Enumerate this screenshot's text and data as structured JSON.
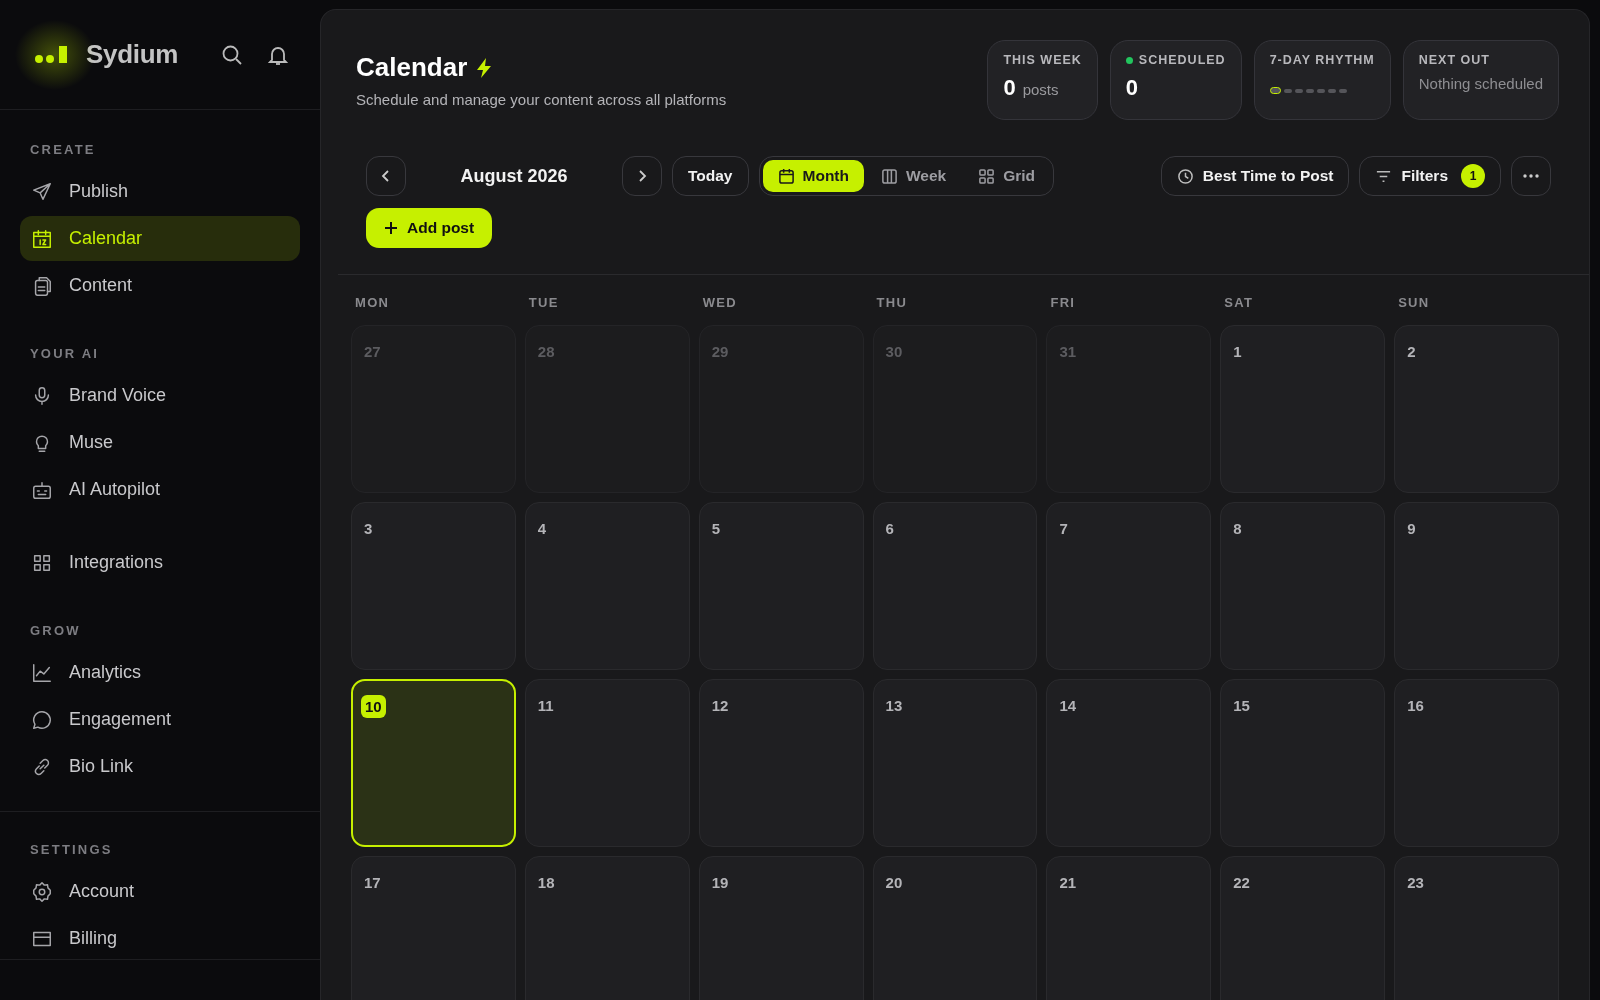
{
  "brand": {
    "name": "Sydium"
  },
  "sidebar": {
    "sections": [
      {
        "title": "CREATE",
        "items": [
          {
            "label": "Publish",
            "selected": false
          },
          {
            "label": "Calendar",
            "selected": true
          },
          {
            "label": "Content",
            "selected": false
          }
        ]
      },
      {
        "title": "YOUR AI",
        "items": [
          {
            "label": "Brand Voice",
            "selected": false
          },
          {
            "label": "Muse",
            "selected": false
          },
          {
            "label": "AI Autopilot",
            "selected": false
          }
        ]
      },
      {
        "items": [
          {
            "label": "Integrations",
            "selected": false
          }
        ]
      },
      {
        "title": "GROW",
        "items": [
          {
            "label": "Analytics",
            "selected": false
          },
          {
            "label": "Engagement",
            "selected": false
          },
          {
            "label": "Bio Link",
            "selected": false
          }
        ]
      },
      {
        "title": "SETTINGS",
        "items": [
          {
            "label": "Account",
            "selected": false
          },
          {
            "label": "Billing",
            "selected": false
          }
        ]
      }
    ]
  },
  "header": {
    "title": "Calendar",
    "subtitle": "Schedule and manage your content across all platforms"
  },
  "stats": [
    {
      "kind": "count",
      "label": "THIS WEEK",
      "value": "0",
      "unit": "posts"
    },
    {
      "kind": "status",
      "label": "SCHEDULED",
      "value": "0",
      "color": "#22c55e"
    },
    {
      "kind": "rhythm",
      "label": "7-DAY RHYTHM",
      "days": [
        {
          "today": true
        },
        {
          "today": false
        },
        {
          "today": false
        },
        {
          "today": false
        },
        {
          "today": false
        },
        {
          "today": false
        },
        {
          "today": false
        }
      ]
    },
    {
      "kind": "next",
      "label": "NEXT OUT",
      "value": "Nothing scheduled"
    }
  ],
  "toolbar": {
    "month": "August 2026",
    "today": "Today",
    "views": [
      {
        "label": "Month",
        "selected": true
      },
      {
        "label": "Week",
        "selected": false
      },
      {
        "label": "Grid",
        "selected": false
      }
    ],
    "best_time": "Best Time to Post",
    "filters": {
      "label": "Filters",
      "count": "1"
    },
    "add_post": "Add post"
  },
  "calendar": {
    "weekdays": [
      "MON",
      "TUE",
      "WED",
      "THU",
      "FRI",
      "SAT",
      "SUN"
    ],
    "days": [
      {
        "label": "27",
        "muted": true,
        "today": false
      },
      {
        "label": "28",
        "muted": true,
        "today": false
      },
      {
        "label": "29",
        "muted": true,
        "today": false
      },
      {
        "label": "30",
        "muted": true,
        "today": false
      },
      {
        "label": "31",
        "muted": true,
        "today": false
      },
      {
        "label": "1",
        "muted": false,
        "today": false
      },
      {
        "label": "2",
        "muted": false,
        "today": false
      },
      {
        "label": "3",
        "muted": false,
        "today": false
      },
      {
        "label": "4",
        "muted": false,
        "today": false
      },
      {
        "label": "5",
        "muted": false,
        "today": false
      },
      {
        "label": "6",
        "muted": false,
        "today": false
      },
      {
        "label": "7",
        "muted": false,
        "today": false
      },
      {
        "label": "8",
        "muted": false,
        "today": false
      },
      {
        "label": "9",
        "muted": false,
        "today": false
      },
      {
        "label": "10",
        "muted": false,
        "today": true
      },
      {
        "label": "11",
        "muted": false,
        "today": false
      },
      {
        "label": "12",
        "muted": false,
        "today": false
      },
      {
        "label": "13",
        "muted": false,
        "today": false
      },
      {
        "label": "14",
        "muted": false,
        "today": false
      },
      {
        "label": "15",
        "muted": false,
        "today": false
      },
      {
        "label": "16",
        "muted": false,
        "today": false
      },
      {
        "label": "17",
        "muted": false,
        "today": false
      },
      {
        "label": "18",
        "muted": false,
        "today": false
      },
      {
        "label": "19",
        "muted": false,
        "today": false
      },
      {
        "label": "20",
        "muted": false,
        "today": false
      },
      {
        "label": "21",
        "muted": false,
        "today": false
      },
      {
        "label": "22",
        "muted": false,
        "today": false
      },
      {
        "label": "23",
        "muted": false,
        "today": false
      }
    ]
  }
}
